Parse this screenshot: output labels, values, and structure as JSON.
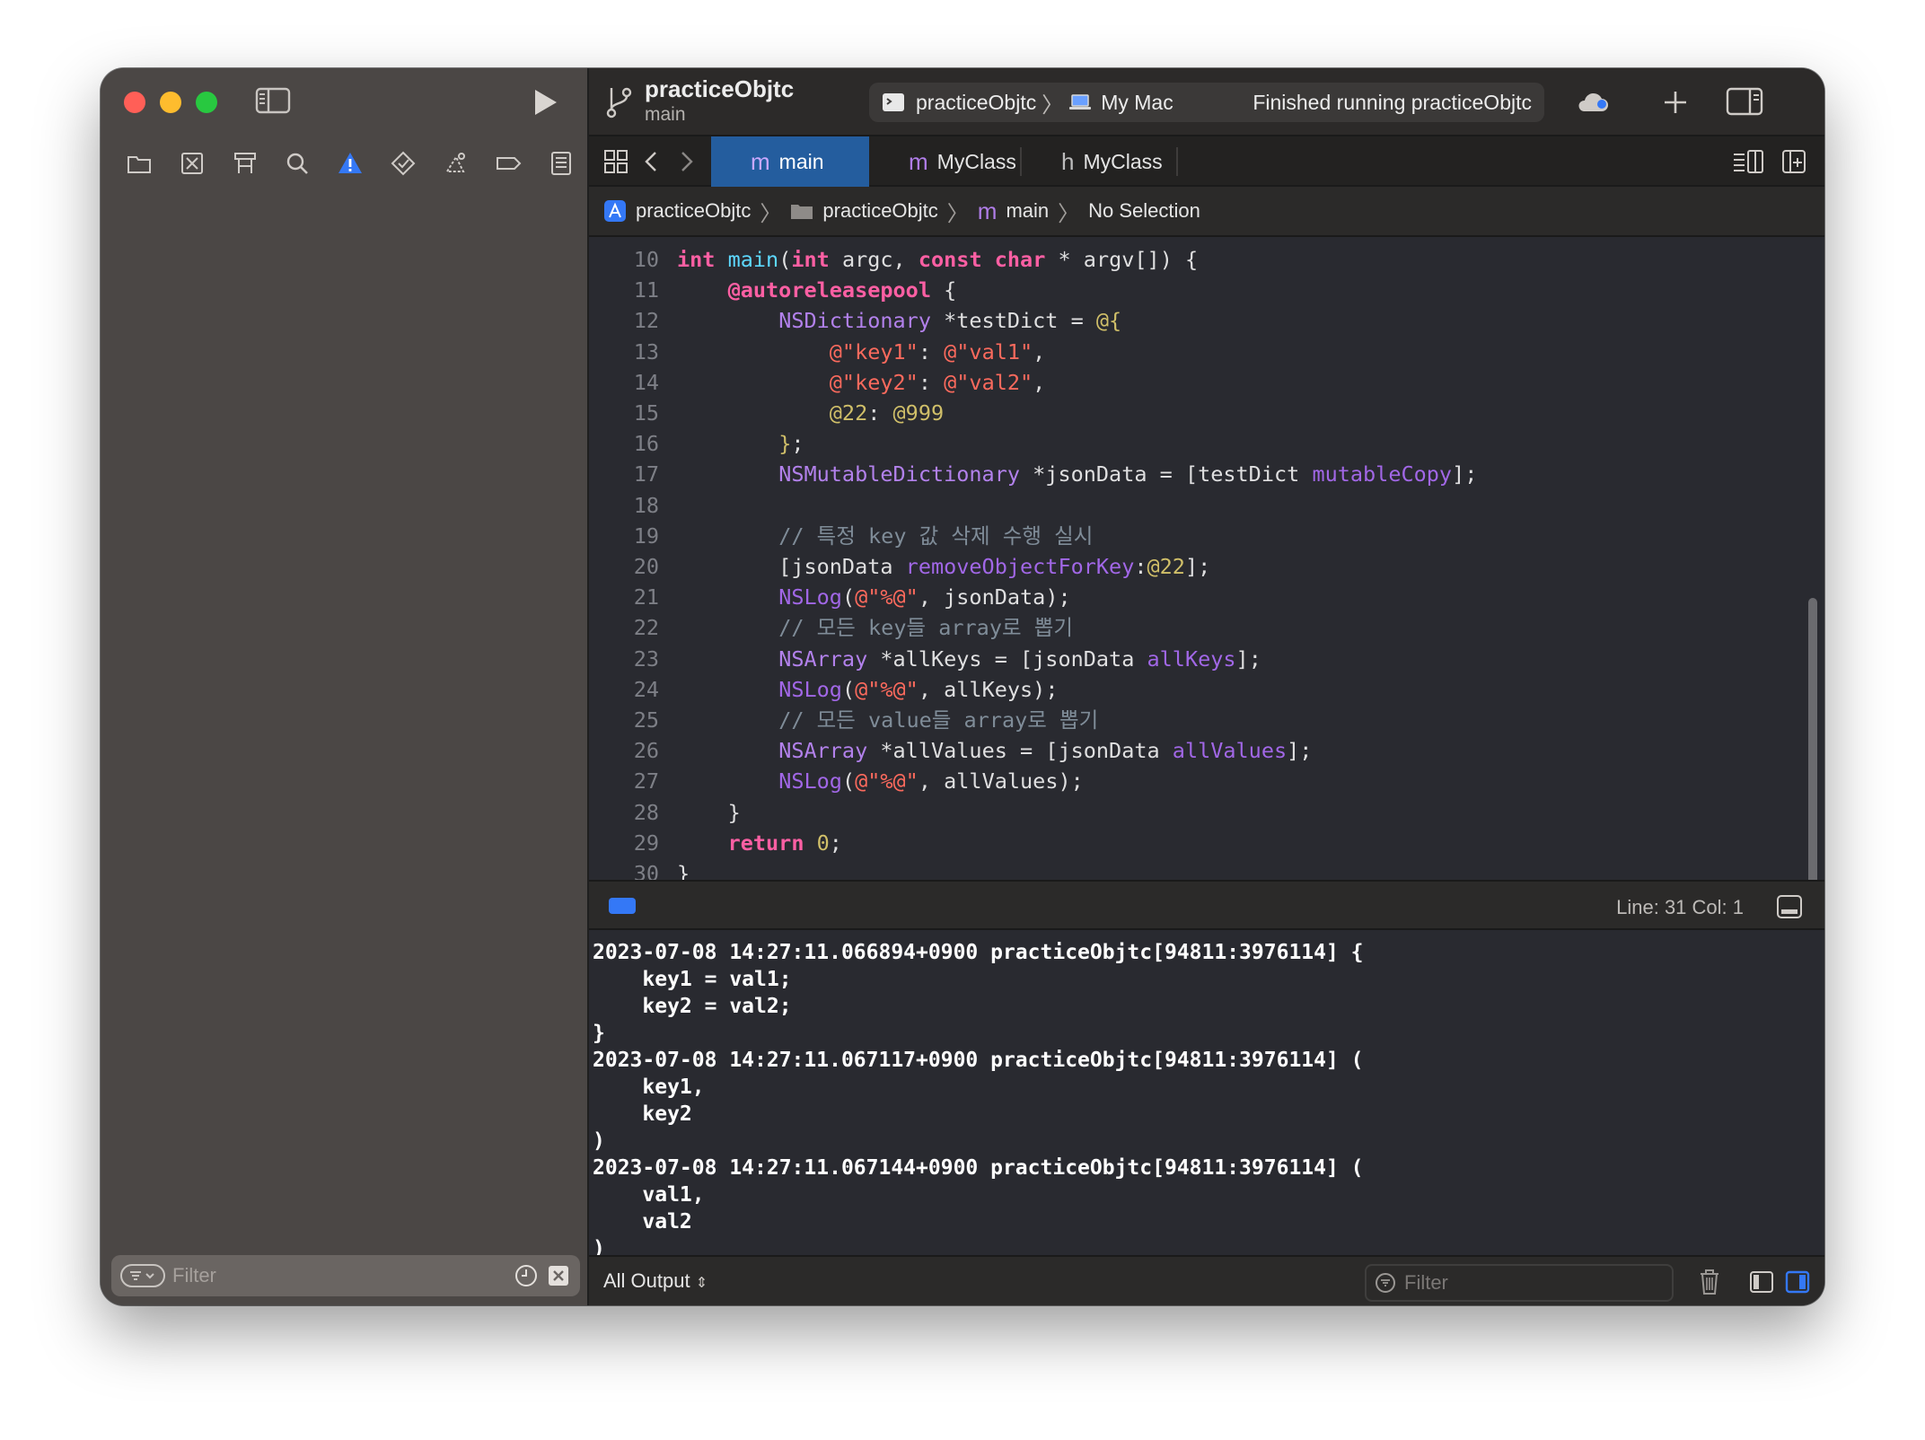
{
  "toolbar": {
    "project_title": "practiceObjtc",
    "branch": "main",
    "scheme": "practiceObjtc",
    "destination": "My Mac",
    "status": "Finished running practiceObjtc"
  },
  "tabs": [
    {
      "label": "main",
      "icon": "m",
      "active": true
    },
    {
      "label": "MyClass",
      "icon": "m",
      "active": false
    },
    {
      "label": "MyClass",
      "icon": "h",
      "active": false
    }
  ],
  "jumpbar": {
    "project": "practiceObjtc",
    "folder": "practiceObjtc",
    "file": "main",
    "selection": "No Selection"
  },
  "code_lines": [
    {
      "n": "10",
      "html": "<span class='kw'>int</span> <span class='ty'>main</span>(<span class='kw'>int</span> argc, <span class='kw'>const</span> <span class='kw'>char</span> * argv[]) {"
    },
    {
      "n": "11",
      "html": "    <span class='kw'>@autoreleasepool</span> {"
    },
    {
      "n": "12",
      "html": "        <span class='cl'>NSDictionary</span> *testDict = <span class='nu'>@{</span>"
    },
    {
      "n": "13",
      "html": "            <span class='st'>@\"key1\"</span>: <span class='st'>@\"val1\"</span>,"
    },
    {
      "n": "14",
      "html": "            <span class='st'>@\"key2\"</span>: <span class='st'>@\"val2\"</span>,"
    },
    {
      "n": "15",
      "html": "            <span class='nu'>@22</span>: <span class='nu'>@999</span>"
    },
    {
      "n": "16",
      "html": "        <span class='nu'>}</span>;"
    },
    {
      "n": "17",
      "html": "        <span class='cl'>NSMutableDictionary</span> *jsonData = [testDict <span class='fn'>mutableCopy</span>];"
    },
    {
      "n": "18",
      "html": ""
    },
    {
      "n": "19",
      "html": "        <span class='cm'>// 특정 key 값 삭제 수행 실시</span>"
    },
    {
      "n": "20",
      "html": "        [jsonData <span class='fn'>removeObjectForKey</span>:<span class='nu'>@22</span>];"
    },
    {
      "n": "21",
      "html": "        <span class='fn'>NSLog</span>(<span class='st'>@\"%@\"</span>, jsonData);"
    },
    {
      "n": "22",
      "html": "        <span class='cm'>// 모든 key들 array로 뽑기</span>"
    },
    {
      "n": "23",
      "html": "        <span class='cl'>NSArray</span> *allKeys = [jsonData <span class='fn'>allKeys</span>];"
    },
    {
      "n": "24",
      "html": "        <span class='fn'>NSLog</span>(<span class='st'>@\"%@\"</span>, allKeys);"
    },
    {
      "n": "25",
      "html": "        <span class='cm'>// 모든 value들 array로 뽑기</span>"
    },
    {
      "n": "26",
      "html": "        <span class='cl'>NSArray</span> *allValues = [jsonData <span class='fn'>allValues</span>];"
    },
    {
      "n": "27",
      "html": "        <span class='fn'>NSLog</span>(<span class='st'>@\"%@\"</span>, allValues);"
    },
    {
      "n": "28",
      "html": "    }"
    },
    {
      "n": "29",
      "html": "    <span class='kw'>return</span> <span class='nu'>0</span>;"
    },
    {
      "n": "30",
      "html": "}"
    }
  ],
  "debugbar": {
    "line_col": "Line: 31  Col: 1"
  },
  "console_lines": [
    "2023-07-08 14:27:11.066894+0900 practiceObjtc[94811:3976114] {",
    "    key1 = val1;",
    "    key2 = val2;",
    "}",
    "2023-07-08 14:27:11.067117+0900 practiceObjtc[94811:3976114] (",
    "    key1,",
    "    key2",
    ")",
    "2023-07-08 14:27:11.067144+0900 practiceObjtc[94811:3976114] (",
    "    val1,",
    "    val2",
    ")"
  ],
  "console_footer": {
    "output_select": "All Output",
    "filter_placeholder": "Filter"
  },
  "sidebar": {
    "filter_placeholder": "Filter",
    "nav_icons": [
      "folder-icon",
      "source-control-icon",
      "symbol-icon",
      "search-icon",
      "issue-warning-icon",
      "test-icon",
      "debug-icon",
      "breakpoint-icon",
      "report-icon"
    ]
  },
  "colors": {
    "accent": "#245d9e",
    "keyword": "#fc5fa3",
    "string": "#fc6a5d",
    "number": "#d0bf69",
    "comment": "#7f8c98",
    "method": "#a167e6"
  }
}
